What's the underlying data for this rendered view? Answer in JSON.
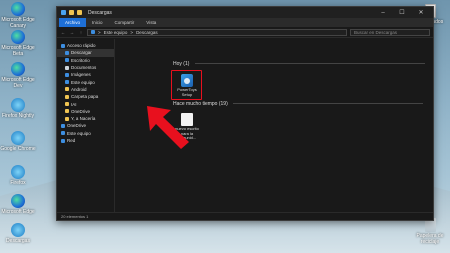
{
  "desktop": {
    "left_icons": [
      {
        "label": "Microsoft Edge Canary",
        "kind": "edge"
      },
      {
        "label": "Microsoft Edge Beta",
        "kind": "edge"
      },
      {
        "label": "Microsoft Edge Dev",
        "kind": "edge"
      },
      {
        "label": "Firefox Nightly",
        "kind": "globe"
      },
      {
        "label": "Google Chrome",
        "kind": "globe"
      },
      {
        "label": "Firefox",
        "kind": "globe"
      },
      {
        "label": "Microsoft Edge",
        "kind": "edge"
      },
      {
        "label": "Descargas",
        "kind": "globe"
      }
    ],
    "right_icons": [
      {
        "label": "Certificados",
        "kind": "file"
      },
      {
        "label": "Papelera de reciclaje",
        "kind": "trash"
      }
    ]
  },
  "window": {
    "title": "Descargas",
    "ribbon_tabs": [
      "Archivo",
      "Inicio",
      "Compartir",
      "Vista"
    ],
    "active_tab": "Archivo",
    "breadcrumb": [
      "Este equipo",
      "Descargas"
    ],
    "search_placeholder": "Buscar en Descargas",
    "min_glyph": "–",
    "max_glyph": "☐",
    "close_glyph": "✕",
    "back_glyph": "←",
    "forward_glyph": "→",
    "up_glyph": "↑",
    "sep_glyph": ">",
    "sidebar": [
      {
        "label": "Acceso rápido",
        "icon": "b",
        "sub": false
      },
      {
        "label": "Descargar",
        "icon": "b",
        "sub": true,
        "active": true
      },
      {
        "label": "Escritorio",
        "icon": "b",
        "sub": true
      },
      {
        "label": "Documentos",
        "icon": "w",
        "sub": true
      },
      {
        "label": "Imágenes",
        "icon": "b",
        "sub": true
      },
      {
        "label": "Este equipo",
        "icon": "b",
        "sub": true
      },
      {
        "label": "Android",
        "icon": "y",
        "sub": true
      },
      {
        "label": "Carpeta papa",
        "icon": "y",
        "sub": true
      },
      {
        "label": "IAI",
        "icon": "y",
        "sub": true
      },
      {
        "label": "OneDrive",
        "icon": "y",
        "sub": true
      },
      {
        "label": "Y, a Nacería",
        "icon": "y",
        "sub": true
      },
      {
        "label": "OneDrive",
        "icon": "b",
        "sub": false
      },
      {
        "label": "Este equipo",
        "icon": "b",
        "sub": false
      },
      {
        "label": "Red",
        "icon": "b",
        "sub": false
      }
    ],
    "groups": [
      {
        "header": "Hoy (1)"
      },
      {
        "header": "Hace mucho tiempo (19)"
      }
    ],
    "files": [
      {
        "name": "PowerToys Setup",
        "kind": "setup"
      },
      {
        "name": "nuevo escrito para la comunid...",
        "kind": "doc"
      }
    ],
    "status": "20 elementos  1"
  },
  "colors": {
    "accent": "#1e6fd6",
    "highlight": "#e8101e",
    "window_bg": "#191919"
  }
}
